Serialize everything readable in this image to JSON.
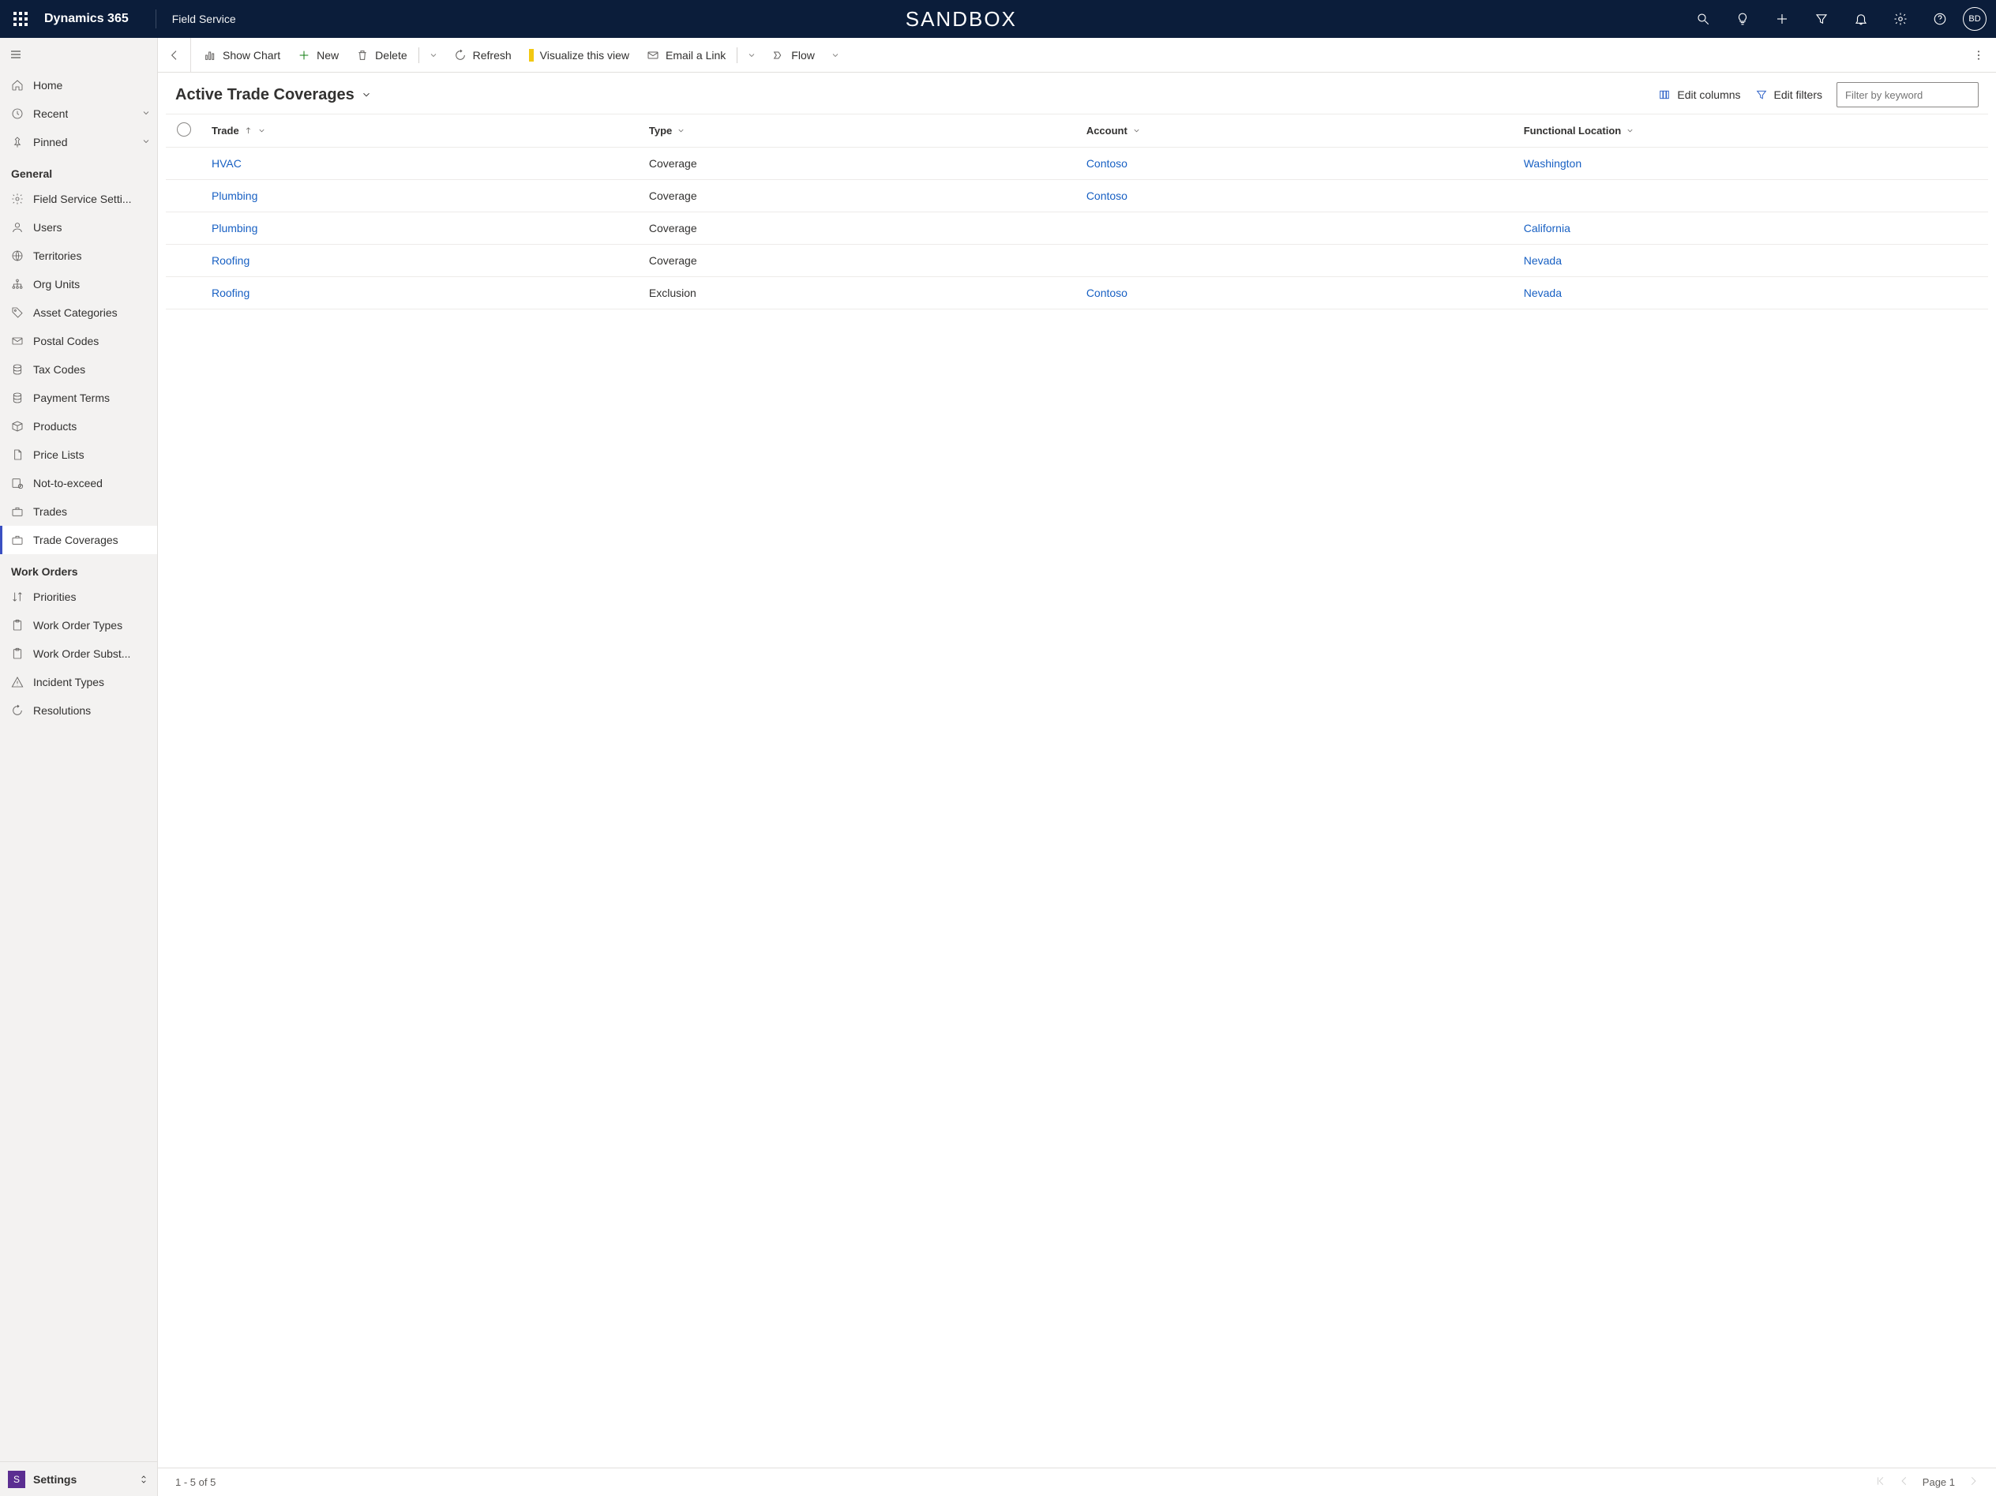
{
  "topbar": {
    "product": "Dynamics 365",
    "app": "Field Service",
    "env": "SANDBOX",
    "avatar": "BD"
  },
  "sidebar": {
    "top": [
      {
        "icon": "home",
        "label": "Home"
      },
      {
        "icon": "clock",
        "label": "Recent",
        "expandable": true
      },
      {
        "icon": "pin",
        "label": "Pinned",
        "expandable": true
      }
    ],
    "group_general": "General",
    "general": [
      {
        "icon": "gear",
        "label": "Field Service Setti..."
      },
      {
        "icon": "user",
        "label": "Users"
      },
      {
        "icon": "globe",
        "label": "Territories"
      },
      {
        "icon": "org",
        "label": "Org Units"
      },
      {
        "icon": "tag",
        "label": "Asset Categories"
      },
      {
        "icon": "mail",
        "label": "Postal Codes"
      },
      {
        "icon": "db",
        "label": "Tax Codes"
      },
      {
        "icon": "db",
        "label": "Payment Terms"
      },
      {
        "icon": "box",
        "label": "Products"
      },
      {
        "icon": "doc",
        "label": "Price Lists"
      },
      {
        "icon": "nte",
        "label": "Not-to-exceed"
      },
      {
        "icon": "briefcase",
        "label": "Trades"
      },
      {
        "icon": "briefcase",
        "label": "Trade Coverages",
        "active": true
      }
    ],
    "group_workorders": "Work Orders",
    "workorders": [
      {
        "icon": "sort",
        "label": "Priorities"
      },
      {
        "icon": "clip",
        "label": "Work Order Types"
      },
      {
        "icon": "clip",
        "label": "Work Order Subst..."
      },
      {
        "icon": "warn",
        "label": "Incident Types"
      },
      {
        "icon": "refresh",
        "label": "Resolutions"
      }
    ],
    "switcher": {
      "tile": "S",
      "label": "Settings"
    }
  },
  "commands": {
    "show_chart": "Show Chart",
    "new": "New",
    "delete": "Delete",
    "refresh": "Refresh",
    "visualize": "Visualize this view",
    "email": "Email a Link",
    "flow": "Flow"
  },
  "view": {
    "title": "Active Trade Coverages",
    "edit_columns": "Edit columns",
    "edit_filters": "Edit filters",
    "filter_placeholder": "Filter by keyword"
  },
  "columns": {
    "trade": "Trade",
    "type": "Type",
    "account": "Account",
    "location": "Functional Location"
  },
  "rows": [
    {
      "trade": "HVAC",
      "type": "Coverage",
      "account": "Contoso",
      "location": "Washington"
    },
    {
      "trade": "Plumbing",
      "type": "Coverage",
      "account": "Contoso",
      "location": ""
    },
    {
      "trade": "Plumbing",
      "type": "Coverage",
      "account": "",
      "location": "California"
    },
    {
      "trade": "Roofing",
      "type": "Coverage",
      "account": "",
      "location": "Nevada"
    },
    {
      "trade": "Roofing",
      "type": "Exclusion",
      "account": "Contoso",
      "location": "Nevada"
    }
  ],
  "status": {
    "range": "1 - 5 of 5",
    "page": "Page 1"
  }
}
